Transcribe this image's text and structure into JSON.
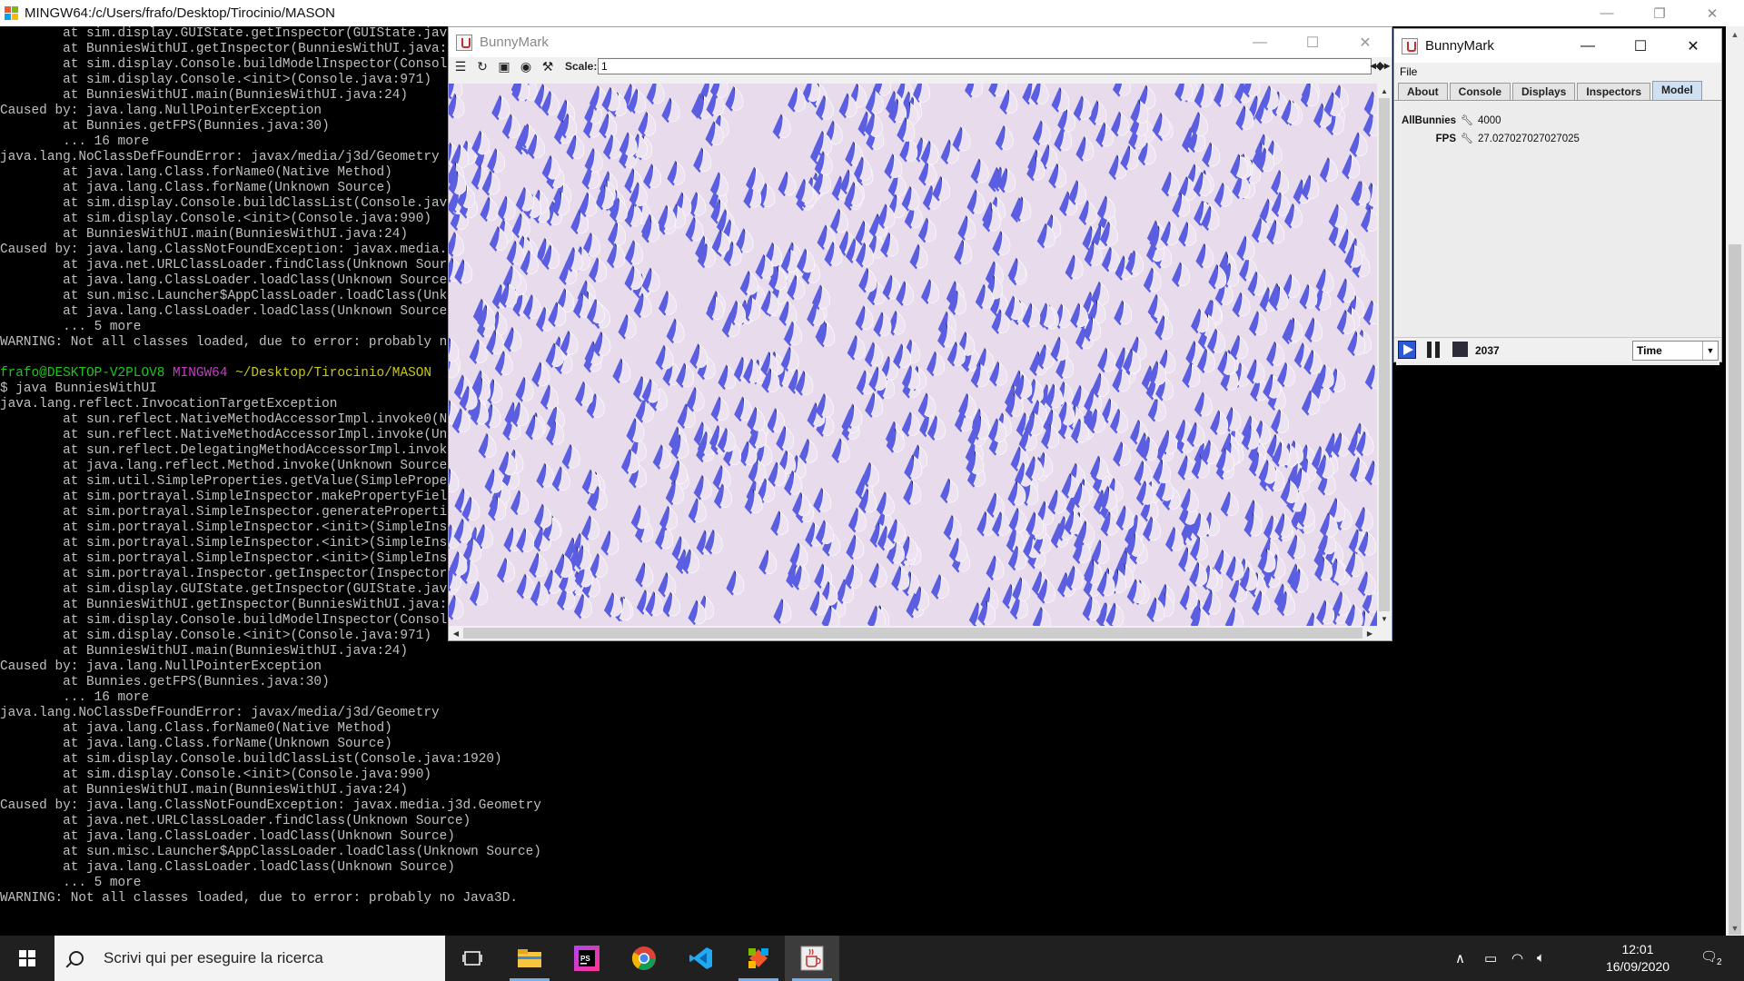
{
  "terminal": {
    "title": "MINGW64:/c/Users/frafo/Desktop/Tirocinio/MASON",
    "lines": [
      {
        "t": "        at sim.display.GUIState.getInspector(GUIState.java:536)"
      },
      {
        "t": "        at BunniesWithUI.getInspector(BunniesWithUI.java:35)"
      },
      {
        "t": "        at sim.display.Console.buildModelInspector(Console.java:1044)"
      },
      {
        "t": "        at sim.display.Console.<init>(Console.java:971)"
      },
      {
        "t": "        at BunniesWithUI.main(BunniesWithUI.java:24)"
      },
      {
        "t": "Caused by: java.lang.NullPointerException"
      },
      {
        "t": "        at Bunnies.getFPS(Bunnies.java:30)"
      },
      {
        "t": "        ... 16 more"
      },
      {
        "t": "java.lang.NoClassDefFoundError: javax/media/j3d/Geometry"
      },
      {
        "t": "        at java.lang.Class.forName0(Native Method)"
      },
      {
        "t": "        at java.lang.Class.forName(Unknown Source)"
      },
      {
        "t": "        at sim.display.Console.buildClassList(Console.java:1920)"
      },
      {
        "t": "        at sim.display.Console.<init>(Console.java:990)"
      },
      {
        "t": "        at BunniesWithUI.main(BunniesWithUI.java:24)"
      },
      {
        "t": "Caused by: java.lang.ClassNotFoundException: javax.media.j3d.Geometry"
      },
      {
        "t": "        at java.net.URLClassLoader.findClass(Unknown Source)"
      },
      {
        "t": "        at java.lang.ClassLoader.loadClass(Unknown Source)"
      },
      {
        "t": "        at sun.misc.Launcher$AppClassLoader.loadClass(Unknown Source)"
      },
      {
        "t": "        at java.lang.ClassLoader.loadClass(Unknown Source)"
      },
      {
        "t": "        ... 5 more"
      },
      {
        "t": "WARNING: Not all classes loaded, due to error: probably no Java3D."
      },
      {
        "t": ""
      },
      {
        "t": "",
        "prompt": {
          "user": "frafo@DESKTOP-V2PLOV8",
          "shell": "MINGW64",
          "path": "~/Desktop/Tirocinio/MASON"
        }
      },
      {
        "t": "$ java BunniesWithUI"
      },
      {
        "t": "java.lang.reflect.InvocationTargetException"
      },
      {
        "t": "        at sun.reflect.NativeMethodAccessorImpl.invoke0(Native Method)"
      },
      {
        "t": "        at sun.reflect.NativeMethodAccessorImpl.invoke(Unknown Source)"
      },
      {
        "t": "        at sun.reflect.DelegatingMethodAccessorImpl.invoke(Unknown Source)"
      },
      {
        "t": "        at java.lang.reflect.Method.invoke(Unknown Source)"
      },
      {
        "t": "        at sim.util.SimpleProperties.getValue(SimpleProperties.java:485)"
      },
      {
        "t": "        at sim.portrayal.SimpleInspector.makePropertyField(SimpleInspector.java:213)"
      },
      {
        "t": "        at sim.portrayal.SimpleInspector.generateProperties(SimpleInspector.java:385)"
      },
      {
        "t": "        at sim.portrayal.SimpleInspector.<init>(SimpleInspector.java:162)"
      },
      {
        "t": "        at sim.portrayal.SimpleInspector.<init>(SimpleInspector.java:136)"
      },
      {
        "t": "        at sim.portrayal.SimpleInspector.<init>(SimpleInspector.java:110)"
      },
      {
        "t": "        at sim.portrayal.Inspector.getInspector(Inspector.java:162)"
      },
      {
        "t": "        at sim.display.GUIState.getInspector(GUIState.java:536)"
      },
      {
        "t": "        at BunniesWithUI.getInspector(BunniesWithUI.java:35)"
      },
      {
        "t": "        at sim.display.Console.buildModelInspector(Console.java:1044)"
      },
      {
        "t": "        at sim.display.Console.<init>(Console.java:971)"
      },
      {
        "t": "        at BunniesWithUI.main(BunniesWithUI.java:24)"
      },
      {
        "t": "Caused by: java.lang.NullPointerException"
      },
      {
        "t": "        at Bunnies.getFPS(Bunnies.java:30)"
      },
      {
        "t": "        ... 16 more"
      },
      {
        "t": "java.lang.NoClassDefFoundError: javax/media/j3d/Geometry"
      },
      {
        "t": "        at java.lang.Class.forName0(Native Method)"
      },
      {
        "t": "        at java.lang.Class.forName(Unknown Source)"
      },
      {
        "t": "        at sim.display.Console.buildClassList(Console.java:1920)"
      },
      {
        "t": "        at sim.display.Console.<init>(Console.java:990)"
      },
      {
        "t": "        at BunniesWithUI.main(BunniesWithUI.java:24)"
      },
      {
        "t": "Caused by: java.lang.ClassNotFoundException: javax.media.j3d.Geometry"
      },
      {
        "t": "        at java.net.URLClassLoader.findClass(Unknown Source)"
      },
      {
        "t": "        at java.lang.ClassLoader.loadClass(Unknown Source)"
      },
      {
        "t": "        at sun.misc.Launcher$AppClassLoader.loadClass(Unknown Source)"
      },
      {
        "t": "        at java.lang.ClassLoader.loadClass(Unknown Source)"
      },
      {
        "t": "        ... 5 more"
      },
      {
        "t": "WARNING: Not all classes loaded, due to error: probably no Java3D."
      },
      {
        "t": ""
      }
    ]
  },
  "display_window": {
    "title": "BunnyMark",
    "scale_label": "Scale:",
    "scale_value": "1",
    "colors": {
      "bunny_fill": "#ece2f0",
      "bunny_shadow": "#5b5ee0",
      "bunny_dark": "#1f2258",
      "background": "#e8dcec"
    }
  },
  "console_window": {
    "title": "BunnyMark",
    "menu": {
      "file": "File"
    },
    "tabs": [
      {
        "label": "About",
        "active": false
      },
      {
        "label": "Console",
        "active": false
      },
      {
        "label": "Displays",
        "active": false
      },
      {
        "label": "Inspectors",
        "active": false
      },
      {
        "label": "Model",
        "active": true
      }
    ],
    "model_properties": [
      {
        "name": "AllBunnies",
        "value": "4000"
      },
      {
        "name": "FPS",
        "value": "27.027027027027025"
      }
    ],
    "step_count": "2037",
    "time_mode": "Time"
  },
  "taskbar": {
    "search_placeholder": "Scrivi qui per eseguire la ricerca",
    "apps": [
      "task-view",
      "file-explorer",
      "phpstorm",
      "chrome",
      "vscode",
      "git-bash",
      "java"
    ],
    "clock_time": "12:01",
    "clock_date": "16/09/2020",
    "notification_count": "2"
  }
}
